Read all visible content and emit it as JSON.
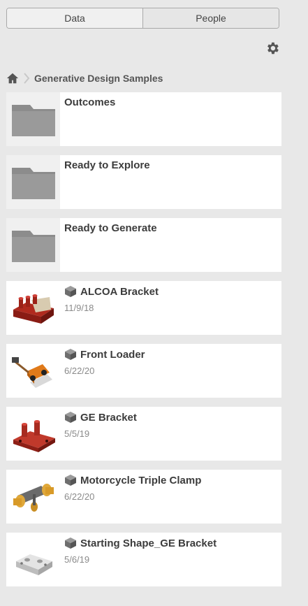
{
  "tabs": {
    "data_label": "Data",
    "people_label": "People"
  },
  "breadcrumb": {
    "project": "Generative Design Samples"
  },
  "folders": [
    {
      "name": "Outcomes"
    },
    {
      "name": "Ready to Explore"
    },
    {
      "name": "Ready to Generate"
    }
  ],
  "designs": [
    {
      "name": "ALCOA Bracket",
      "date": "11/9/18"
    },
    {
      "name": "Front Loader",
      "date": "6/22/20"
    },
    {
      "name": "GE Bracket",
      "date": "5/5/19"
    },
    {
      "name": "Motorcycle Triple Clamp",
      "date": "6/22/20"
    },
    {
      "name": "Starting Shape_GE Bracket",
      "date": "5/6/19"
    }
  ]
}
